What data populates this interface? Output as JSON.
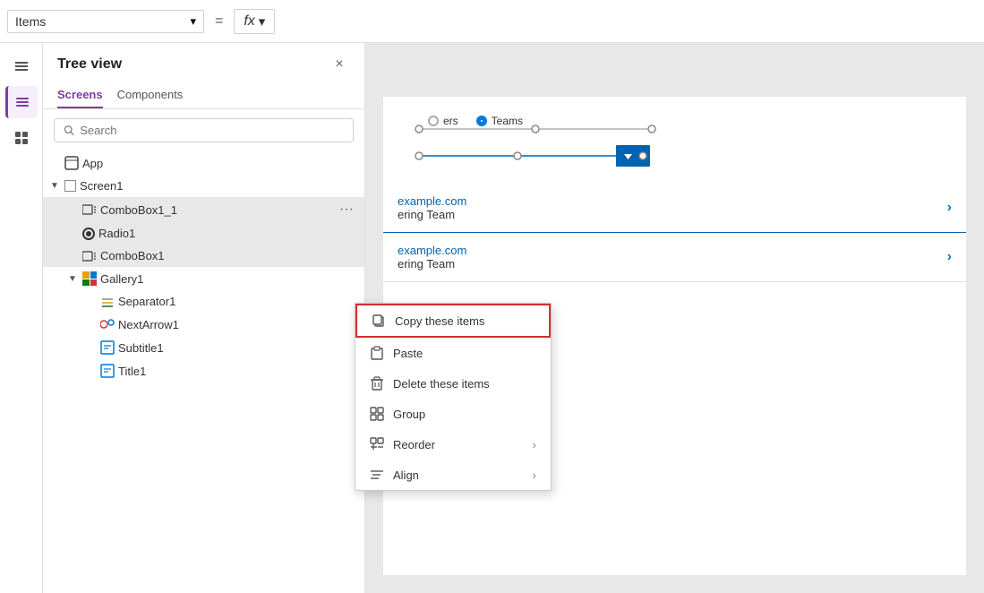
{
  "topbar": {
    "dropdown_label": "Items",
    "dropdown_chevron": "▾",
    "equals": "=",
    "fx_label": "fx",
    "fx_chevron": "▾"
  },
  "tree_panel": {
    "title": "Tree view",
    "close_label": "×",
    "tabs": [
      {
        "id": "screens",
        "label": "Screens",
        "active": true
      },
      {
        "id": "components",
        "label": "Components",
        "active": false
      }
    ],
    "search_placeholder": "Search",
    "items": [
      {
        "id": "app",
        "label": "App",
        "level": 1,
        "type": "app",
        "expanded": false
      },
      {
        "id": "screen1",
        "label": "Screen1",
        "level": 1,
        "type": "screen",
        "expanded": true
      },
      {
        "id": "combobox1_1",
        "label": "ComboBox1_1",
        "level": 2,
        "type": "combobox",
        "selected": true,
        "show_dots": true
      },
      {
        "id": "radio1",
        "label": "Radio1",
        "level": 2,
        "type": "radio",
        "selected": true
      },
      {
        "id": "combobox1",
        "label": "ComboBox1",
        "level": 2,
        "type": "combobox",
        "selected": true
      },
      {
        "id": "gallery1",
        "label": "Gallery1",
        "level": 2,
        "type": "gallery",
        "expanded": true
      },
      {
        "id": "separator1",
        "label": "Separator1",
        "level": 3,
        "type": "separator"
      },
      {
        "id": "nextarrow1",
        "label": "NextArrow1",
        "level": 3,
        "type": "nextarrow"
      },
      {
        "id": "subtitle1",
        "label": "Subtitle1",
        "level": 3,
        "type": "edit"
      },
      {
        "id": "title1",
        "label": "Title1",
        "level": 3,
        "type": "edit"
      }
    ]
  },
  "context_menu": {
    "items": [
      {
        "id": "copy",
        "label": "Copy these items",
        "icon": "copy",
        "highlighted": true
      },
      {
        "id": "paste",
        "label": "Paste",
        "icon": "paste"
      },
      {
        "id": "delete",
        "label": "Delete these items",
        "icon": "delete"
      },
      {
        "id": "group",
        "label": "Group",
        "icon": "group"
      },
      {
        "id": "reorder",
        "label": "Reorder",
        "icon": "reorder",
        "has_arrow": true
      },
      {
        "id": "align",
        "label": "Align",
        "icon": "align",
        "has_arrow": true
      }
    ]
  },
  "canvas": {
    "radio_option_1": "ers",
    "radio_option_2": "Teams",
    "list_item_1_email": "example.com",
    "list_item_1_team": "ering Team",
    "list_item_2_email": "example.com",
    "list_item_2_team": "ering Team"
  },
  "sidebar_icons": [
    {
      "id": "hamburger",
      "label": "menu-icon"
    },
    {
      "id": "layers",
      "label": "layers-icon",
      "active": true
    },
    {
      "id": "grid",
      "label": "grid-icon"
    }
  ]
}
